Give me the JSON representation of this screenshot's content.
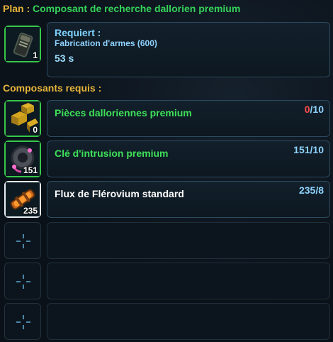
{
  "header": {
    "label": "Plan :",
    "title": "Composant de recherche dallorien premium"
  },
  "plan": {
    "icon": "dark-metal-case-icon",
    "qty": "1",
    "requires_label": "Requiert :",
    "skill": "Fabrication d'armes (600)",
    "time": "53 s"
  },
  "components_title": "Composants requis :",
  "components": [
    {
      "name": "Pièces dalloriennes premium",
      "have": "0",
      "need": "10",
      "qty": "0",
      "icon": "gold-parts-icon",
      "status_color": "#ff4c4c"
    },
    {
      "name": "Clé d'intrusion premium",
      "have": "151",
      "need": "10",
      "qty": "151",
      "icon": "intrusion-key-icon"
    },
    {
      "name": "Flux de Flérovium standard",
      "have": "235",
      "need": "8",
      "qty": "235",
      "icon": "flux-canister-icon"
    }
  ],
  "colors": {
    "label": "#e7b53a",
    "green": "#35d35a",
    "cyan": "#8fd3ff",
    "red": "#ff4c4c"
  }
}
